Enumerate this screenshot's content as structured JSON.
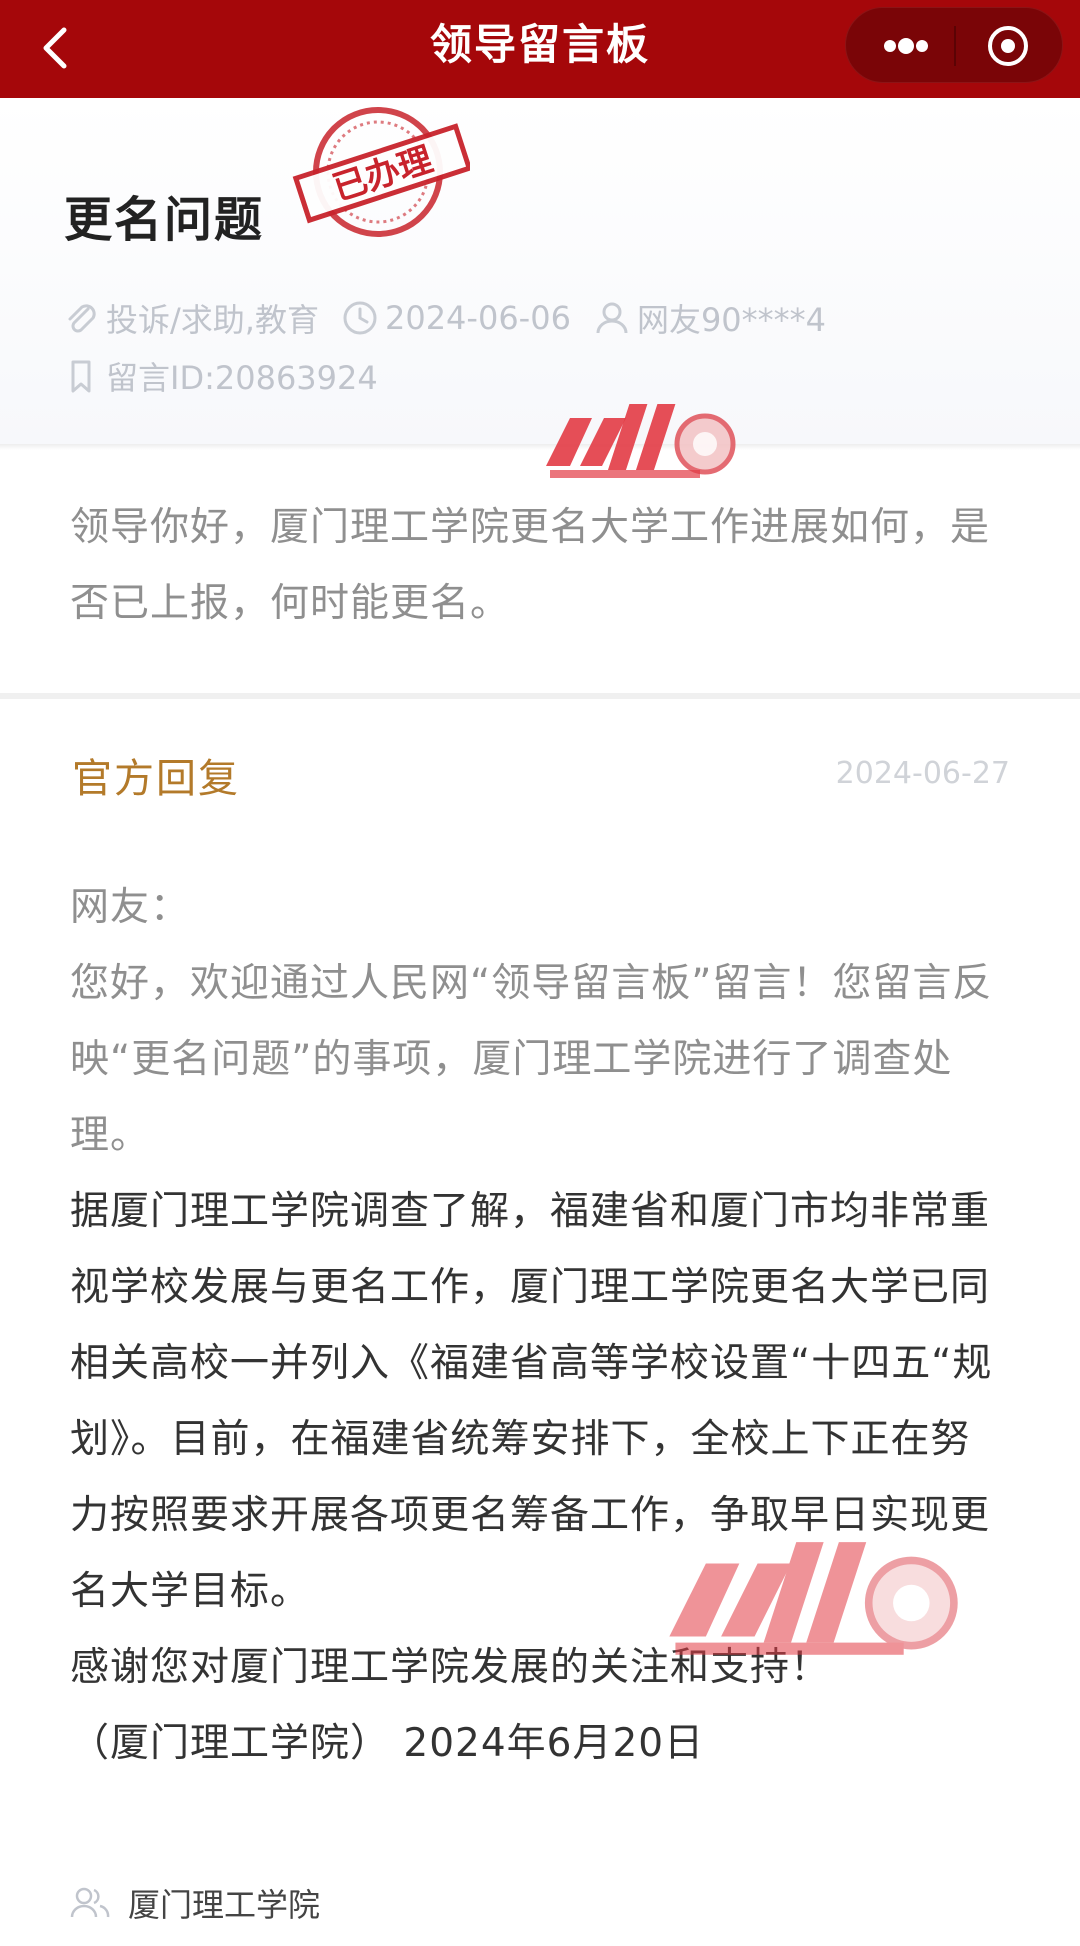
{
  "nav": {
    "title": "领导留言板"
  },
  "post": {
    "title": "更名问题",
    "status_stamp": "已办理",
    "category": "投诉/求助,教育",
    "date": "2024-06-06",
    "author": "网友90****4",
    "message_id": "留言ID:20863924",
    "content": "领导你好，厦门理工学院更名大学工作进展如何，是否已上报，何时能更名。"
  },
  "reply": {
    "label": "官方回复",
    "date": "2024-06-27",
    "greeting": "网友：",
    "para1": "您好，欢迎通过人民网“领导留言板”留言！您留言反映“更名问题”的事项，厦门理工学院进行了调查处理。",
    "para2": "据厦门理工学院调查了解，福建省和厦门市均非常重视学校发展与更名工作，厦门理工学院更名大学已同相关高校一并列入《福建省高等学校设置“十四五“规划》。目前，在福建省统筹安排下，全校上下正在努力按照要求开展各项更名筹备工作，争取早日实现更名大学目标。",
    "para3": "感谢您对厦门理工学院发展的关注和支持！",
    "signature": "（厦门理工学院） 2024年6月20日"
  },
  "footer": {
    "org_name": "厦门理工学院"
  },
  "colors": {
    "nav_bg": "#a5070a",
    "stamp_red": "#c8232c",
    "reply_label": "#b37a2a"
  }
}
